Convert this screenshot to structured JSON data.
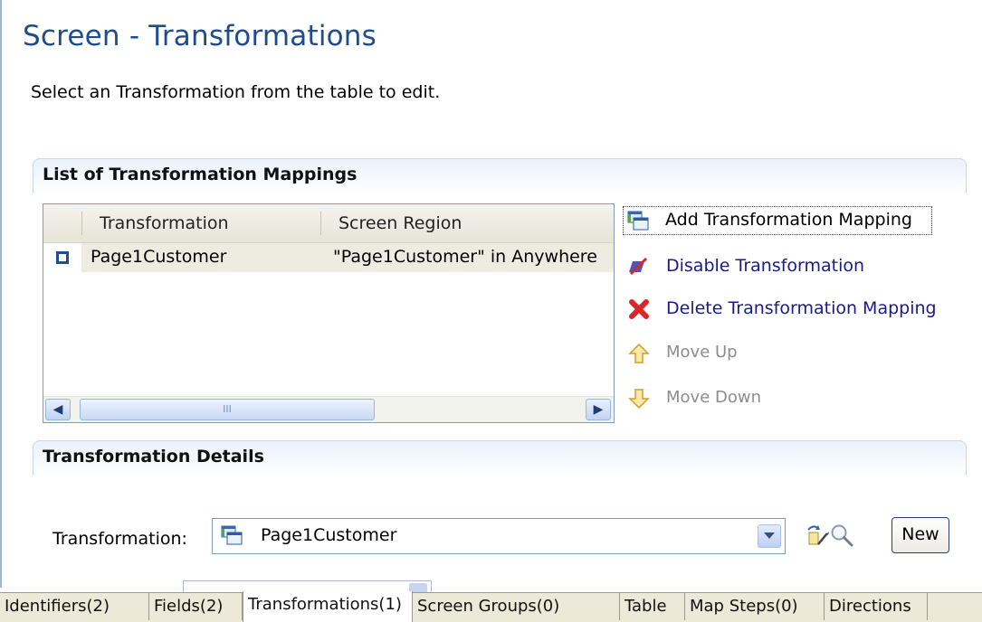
{
  "page": {
    "title": "Screen - Transformations",
    "intro": "Select an Transformation from the table to edit."
  },
  "mappings_section": {
    "header": "List of Transformation Mappings",
    "columns": [
      "Transformation",
      "Screen Region"
    ],
    "rows": [
      {
        "transformation": "Page1Customer",
        "screen_region": "\"Page1Customer\" in Anywhere"
      }
    ],
    "scroll_thumb_glyph": "III"
  },
  "actions": {
    "add": {
      "label": "Add Transformation Mapping",
      "icon": "add-mapping-icon"
    },
    "disable": {
      "label": "Disable Transformation",
      "icon": "disable-icon"
    },
    "delete": {
      "label": "Delete Transformation Mapping",
      "icon": "delete-x-icon"
    },
    "move_up": {
      "label": "Move Up",
      "icon": "arrow-up-icon"
    },
    "move_down": {
      "label": "Move Down",
      "icon": "arrow-down-icon"
    }
  },
  "details_section": {
    "header": "Transformation Details",
    "transformation_label": "Transformation:",
    "transformation_value": "Page1Customer",
    "new_button": "New"
  },
  "tabs": [
    {
      "label": "Identifiers(2)",
      "active": false
    },
    {
      "label": "Fields(2)",
      "active": false
    },
    {
      "label": "Transformations(1)",
      "active": true
    },
    {
      "label": "Screen Groups(0)",
      "active": false
    },
    {
      "label": "Table",
      "active": false
    },
    {
      "label": "Map Steps(0)",
      "active": false
    },
    {
      "label": "Directions",
      "active": false
    }
  ],
  "colors": {
    "title": "#1f4d8c",
    "link": "#1a1a8c",
    "disabled": "#8c8c8c",
    "delete_red": "#d8262a"
  }
}
